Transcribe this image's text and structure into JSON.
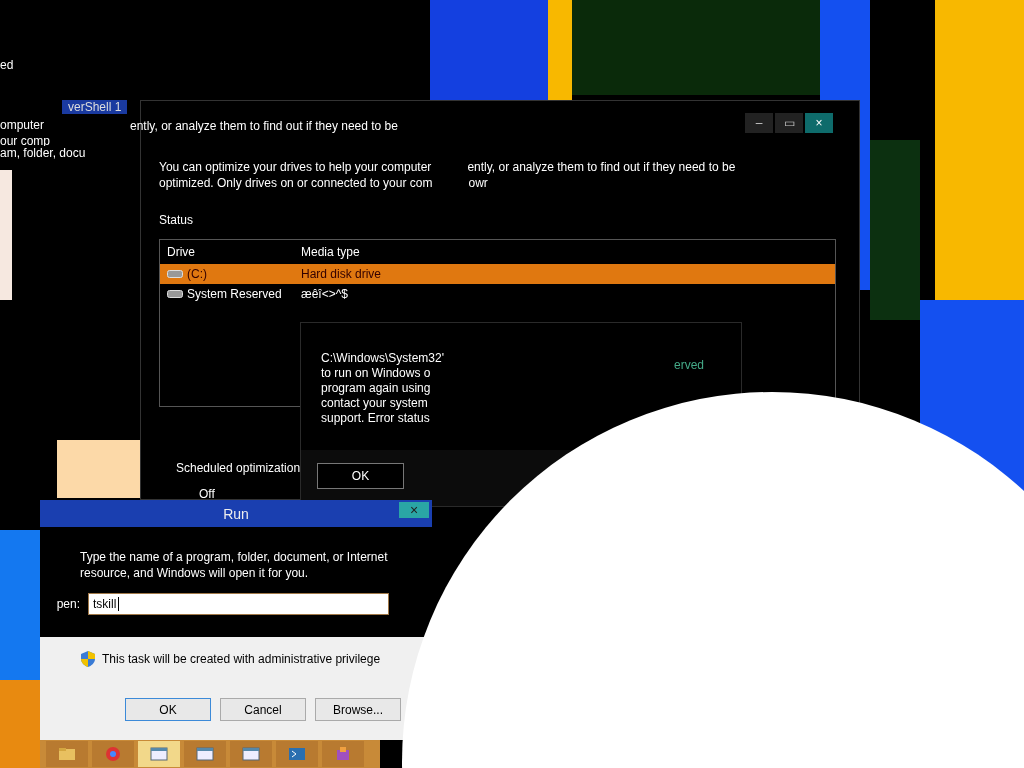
{
  "fragments": {
    "top_left_lines": [
      "ed",
      "omputer",
      "our comp",
      "am, folder, docu"
    ],
    "tab_title": "verShell 1",
    "stray_line": "ently, or analyze them to find out if they need to be",
    "stray_word": "erved"
  },
  "optimize_window": {
    "description": [
      [
        "You can optimize your drives to help your computer",
        "ently, or analyze them to find out if they need to be"
      ],
      [
        "optimized. Only drives on or connected to your com",
        "owr"
      ]
    ],
    "status_label": "Status",
    "columns": [
      "Drive",
      "Media type"
    ],
    "rows": [
      {
        "drive": "(C:)",
        "media_type": "Hard disk drive",
        "selected": true
      },
      {
        "drive": "System Reserved",
        "media_type": "æêî<>^$",
        "selected": false
      }
    ],
    "scheduled_label": "Scheduled optimization",
    "scheduled_value": "Off",
    "window_controls": [
      "–",
      "▭",
      "×"
    ]
  },
  "error_dialog": {
    "lines": [
      "C:\\Windows\\System32'",
      "to run on Windows o",
      "program again using",
      "contact your system",
      "support. Error status"
    ],
    "button": "OK"
  },
  "run_dialog": {
    "title": "Run",
    "close_glyph": "×",
    "description": "Type the name of a program, folder, document, or Internet resource, and Windows will open it for you.",
    "open_label": "pen:",
    "value": "tskill",
    "admin_note": "This task will be created with administrative privilege",
    "buttons": [
      {
        "label": "OK",
        "kind": "default"
      },
      {
        "label": "Cancel",
        "kind": "normal"
      },
      {
        "label": "Browse...",
        "kind": "normal"
      }
    ]
  },
  "taskbar": {
    "apps": [
      {
        "kind": "folder",
        "selected": false
      },
      {
        "kind": "browser",
        "selected": false
      },
      {
        "kind": "window",
        "selected": true
      },
      {
        "kind": "window",
        "selected": false
      },
      {
        "kind": "window",
        "selected": false
      },
      {
        "kind": "console",
        "selected": false
      },
      {
        "kind": "package",
        "selected": false
      }
    ]
  }
}
